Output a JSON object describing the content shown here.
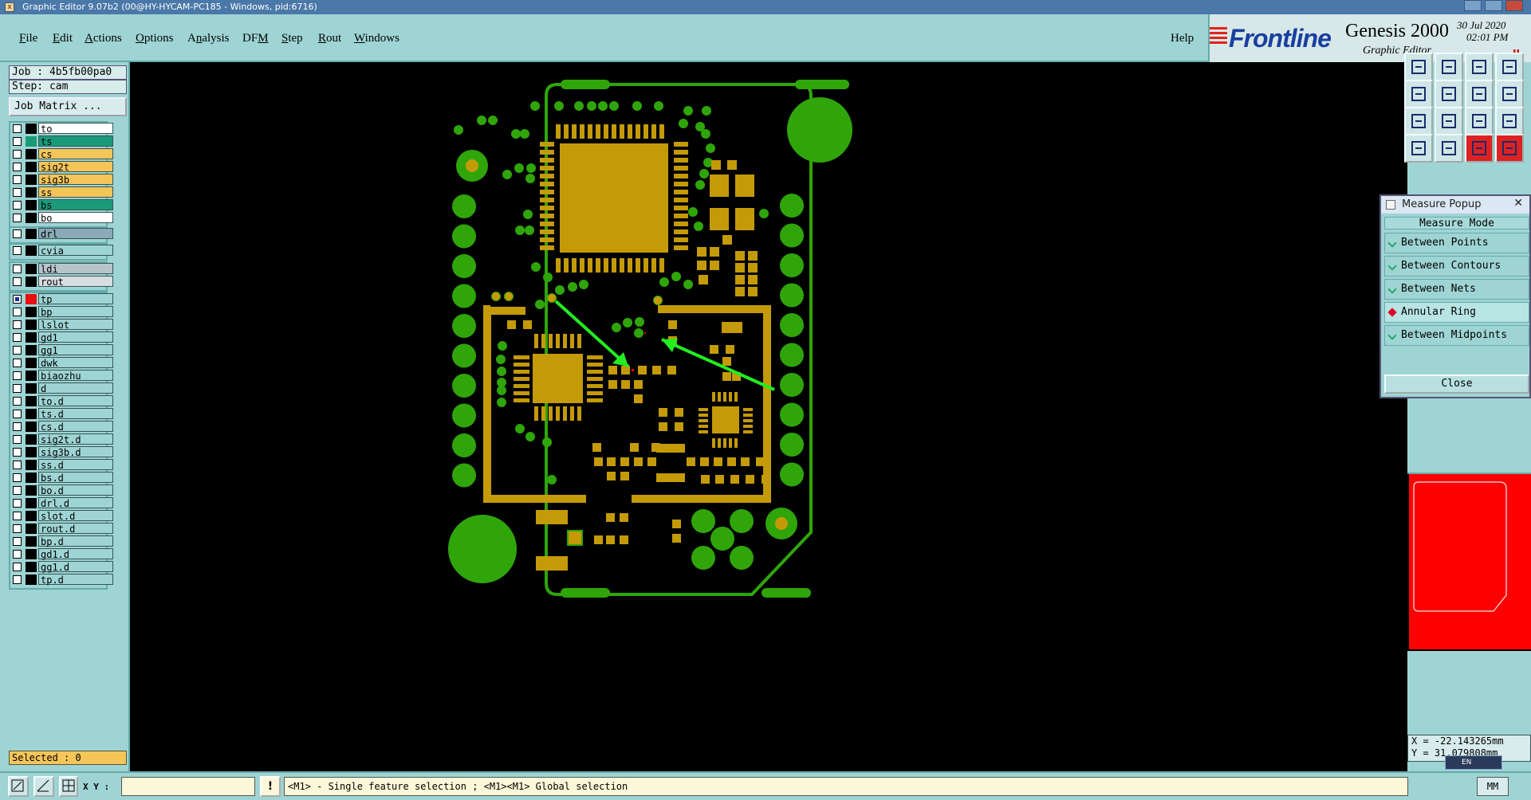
{
  "window": {
    "title": "Graphic Editor 9.07b2 (00@HY-HYCAM-PC185 - Windows, pid:6716)"
  },
  "menu": {
    "items": [
      {
        "pre": "",
        "u": "F",
        "post": "ile"
      },
      {
        "pre": "",
        "u": "E",
        "post": "dit"
      },
      {
        "pre": "",
        "u": "A",
        "post": "ctions"
      },
      {
        "pre": "",
        "u": "O",
        "post": "ptions"
      },
      {
        "pre": "A",
        "u": "n",
        "post": "alysis"
      },
      {
        "pre": "DF",
        "u": "M",
        "post": ""
      },
      {
        "pre": "",
        "u": "S",
        "post": "tep"
      },
      {
        "pre": "",
        "u": "R",
        "post": "out"
      },
      {
        "pre": "",
        "u": "W",
        "post": "indows"
      }
    ],
    "help": "Help"
  },
  "brand": {
    "logo": "Frontline",
    "product": "Genesis 2000",
    "subtitle": "Graphic Editor",
    "date": "30 Jul 2020",
    "time": "02:01 PM"
  },
  "job": {
    "job_label": "Job : 4b5fb00pa0",
    "step_label": "Step: cam",
    "matrix_button": "Job Matrix ..."
  },
  "layers": {
    "board": [
      {
        "name": "to",
        "color": "#ffffff",
        "swatch": "#000000"
      },
      {
        "name": "ts",
        "color": "#1a9a78",
        "swatch": "#1a9a78"
      },
      {
        "name": "cs",
        "color": "#f5c55a",
        "swatch": "#000000"
      },
      {
        "name": "sig2t",
        "color": "#f5c55a",
        "swatch": "#000000"
      },
      {
        "name": "sig3b",
        "color": "#f5c55a",
        "swatch": "#000000"
      },
      {
        "name": "ss",
        "color": "#f5c55a",
        "swatch": "#000000"
      },
      {
        "name": "bs",
        "color": "#1a9a78",
        "swatch": "#000000"
      },
      {
        "name": "bo",
        "color": "#ffffff",
        "swatch": "#000000"
      }
    ],
    "drill": [
      {
        "name": "drl",
        "color": "#8aaab8",
        "swatch": "#000000"
      }
    ],
    "via": [
      {
        "name": "cvia",
        "color": "#9fd4d4",
        "swatch": "#000000"
      }
    ],
    "rout": [
      {
        "name": "ldi",
        "color": "#b8c4cc",
        "swatch": "#000000"
      },
      {
        "name": "rout",
        "color": "#d8dde0",
        "swatch": "#000000"
      }
    ],
    "misc": [
      {
        "name": "tp",
        "color": "#9fd4d4",
        "swatch": "#e81010",
        "checked": true
      },
      {
        "name": "bp",
        "color": "#9fd4d4",
        "swatch": "#000000"
      },
      {
        "name": "lslot",
        "color": "#9fd4d4",
        "swatch": "#000000"
      },
      {
        "name": "gd1",
        "color": "#9fd4d4",
        "swatch": "#000000"
      },
      {
        "name": "gg1",
        "color": "#9fd4d4",
        "swatch": "#000000"
      },
      {
        "name": "dwk",
        "color": "#9fd4d4",
        "swatch": "#000000"
      },
      {
        "name": "biaozhu",
        "color": "#9fd4d4",
        "swatch": "#000000"
      },
      {
        "name": "d",
        "color": "#9fd4d4",
        "swatch": "#000000"
      },
      {
        "name": "to.d",
        "color": "#9fd4d4",
        "swatch": "#000000"
      },
      {
        "name": "ts.d",
        "color": "#9fd4d4",
        "swatch": "#000000"
      },
      {
        "name": "cs.d",
        "color": "#9fd4d4",
        "swatch": "#000000"
      },
      {
        "name": "sig2t.d",
        "color": "#9fd4d4",
        "swatch": "#000000"
      },
      {
        "name": "sig3b.d",
        "color": "#9fd4d4",
        "swatch": "#000000"
      },
      {
        "name": "ss.d",
        "color": "#9fd4d4",
        "swatch": "#000000"
      },
      {
        "name": "bs.d",
        "color": "#9fd4d4",
        "swatch": "#000000"
      },
      {
        "name": "bo.d",
        "color": "#9fd4d4",
        "swatch": "#000000"
      },
      {
        "name": "drl.d",
        "color": "#9fd4d4",
        "swatch": "#000000"
      },
      {
        "name": "slot.d",
        "color": "#9fd4d4",
        "swatch": "#000000"
      },
      {
        "name": "rout.d",
        "color": "#9fd4d4",
        "swatch": "#000000"
      },
      {
        "name": "bp.d",
        "color": "#9fd4d4",
        "swatch": "#000000"
      },
      {
        "name": "gd1.d",
        "color": "#9fd4d4",
        "swatch": "#000000"
      },
      {
        "name": "gg1.d",
        "color": "#9fd4d4",
        "swatch": "#000000"
      },
      {
        "name": "tp.d",
        "color": "#9fd4d4",
        "swatch": "#000000"
      }
    ]
  },
  "selected_label": "Selected : 0",
  "measure": {
    "title": "Measure Popup",
    "mode_title": "Measure Mode",
    "options": [
      {
        "label": "Between Points",
        "active": false
      },
      {
        "label": "Between Contours",
        "active": false
      },
      {
        "label": "Between Nets",
        "active": false
      },
      {
        "label": "Annular Ring",
        "active": true
      },
      {
        "label": "Between Midpoints",
        "active": false
      }
    ],
    "close": "Close"
  },
  "coords": {
    "x": "X = -22.143265mm",
    "y": "Y = 31.079808mm"
  },
  "bottom": {
    "xy_label": "X Y :",
    "xy_value": "",
    "warn": "!",
    "status": "<M1> - Single feature selection ; <M1><M1> Global selection",
    "units": "MM",
    "lang": "EN"
  },
  "colors": {
    "board_outline": "#2fa50a",
    "copper_green": "#2fa50a",
    "pad_gold": "#c49a08",
    "arrow": "#22ee22",
    "panel_bg": "#9fd4d4",
    "minimap_fill": "#ff0000"
  }
}
